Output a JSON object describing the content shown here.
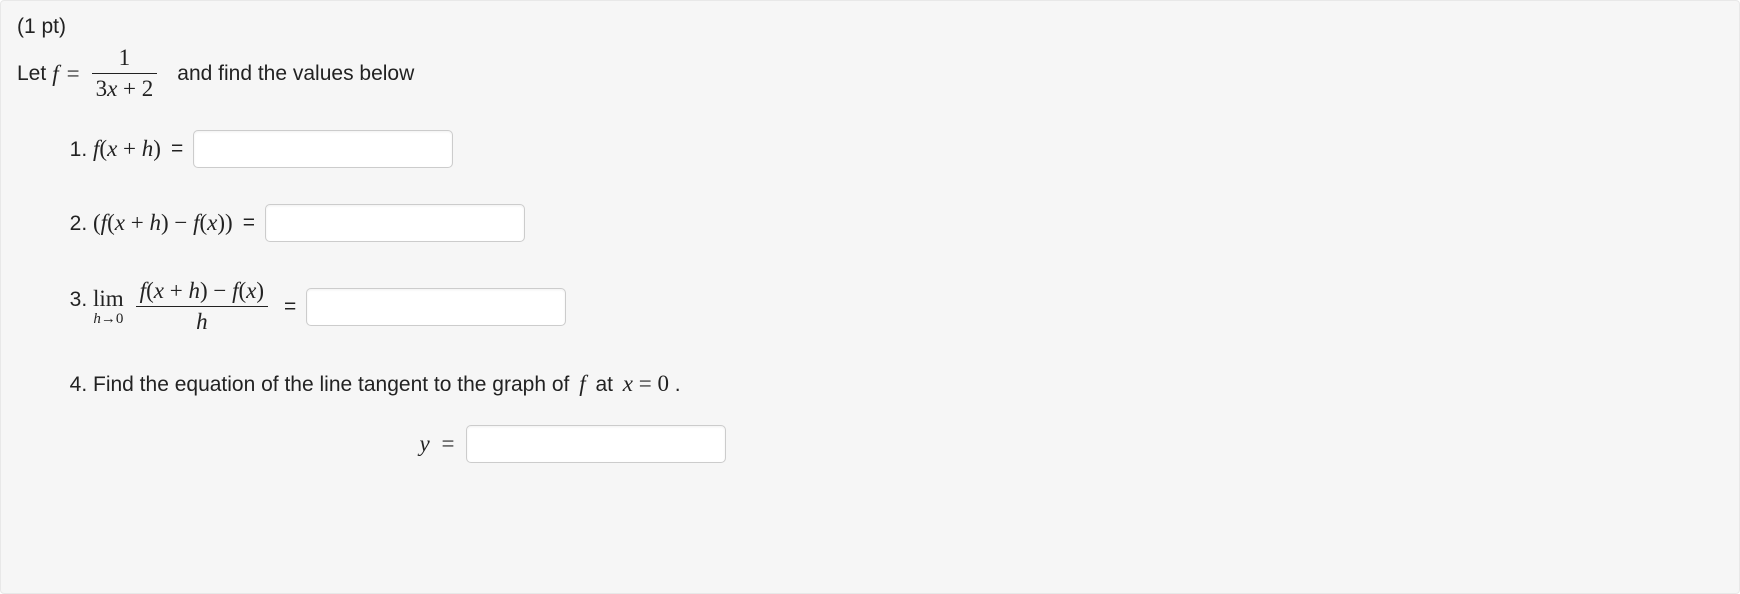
{
  "points_label": "(1 pt)",
  "intro": {
    "let_text": "Let",
    "func_letter": "f",
    "equals": "=",
    "frac_num": "1",
    "frac_den_a": "3",
    "frac_den_var": "x",
    "frac_den_plus": " + ",
    "frac_den_b": "2",
    "tail_text": "and find the values below"
  },
  "q1": {
    "expr_f": "f",
    "expr_lp": "(",
    "expr_x": "x",
    "expr_plus": " + ",
    "expr_h": "h",
    "expr_rp": ")",
    "equals": "="
  },
  "q2": {
    "lp": "(",
    "f1": "f",
    "flp": "(",
    "x": "x",
    "plus": " + ",
    "h": "h",
    "frp": ")",
    "minus": " − ",
    "f2": "f",
    "flp2": "(",
    "x2": "x",
    "frp2": ")",
    "rp": ")",
    "equals": "="
  },
  "q3": {
    "lim": "lim",
    "sub_h": "h",
    "sub_arrow": "→",
    "sub_zero": "0",
    "num_f": "f",
    "num_lp": "(",
    "num_x": "x",
    "num_plus": " + ",
    "num_h": "h",
    "num_rp": ")",
    "num_minus": " − ",
    "num_f2": "f",
    "num_lp2": "(",
    "num_x2": "x",
    "num_rp2": ")",
    "den_h": "h",
    "equals": "="
  },
  "q4": {
    "text_a": "Find the equation of the line tangent to the graph of",
    "f": "f",
    "text_b": "at",
    "x": "x",
    "equals_zero": " = 0",
    "period": ".",
    "y": "y",
    "equals": "="
  }
}
